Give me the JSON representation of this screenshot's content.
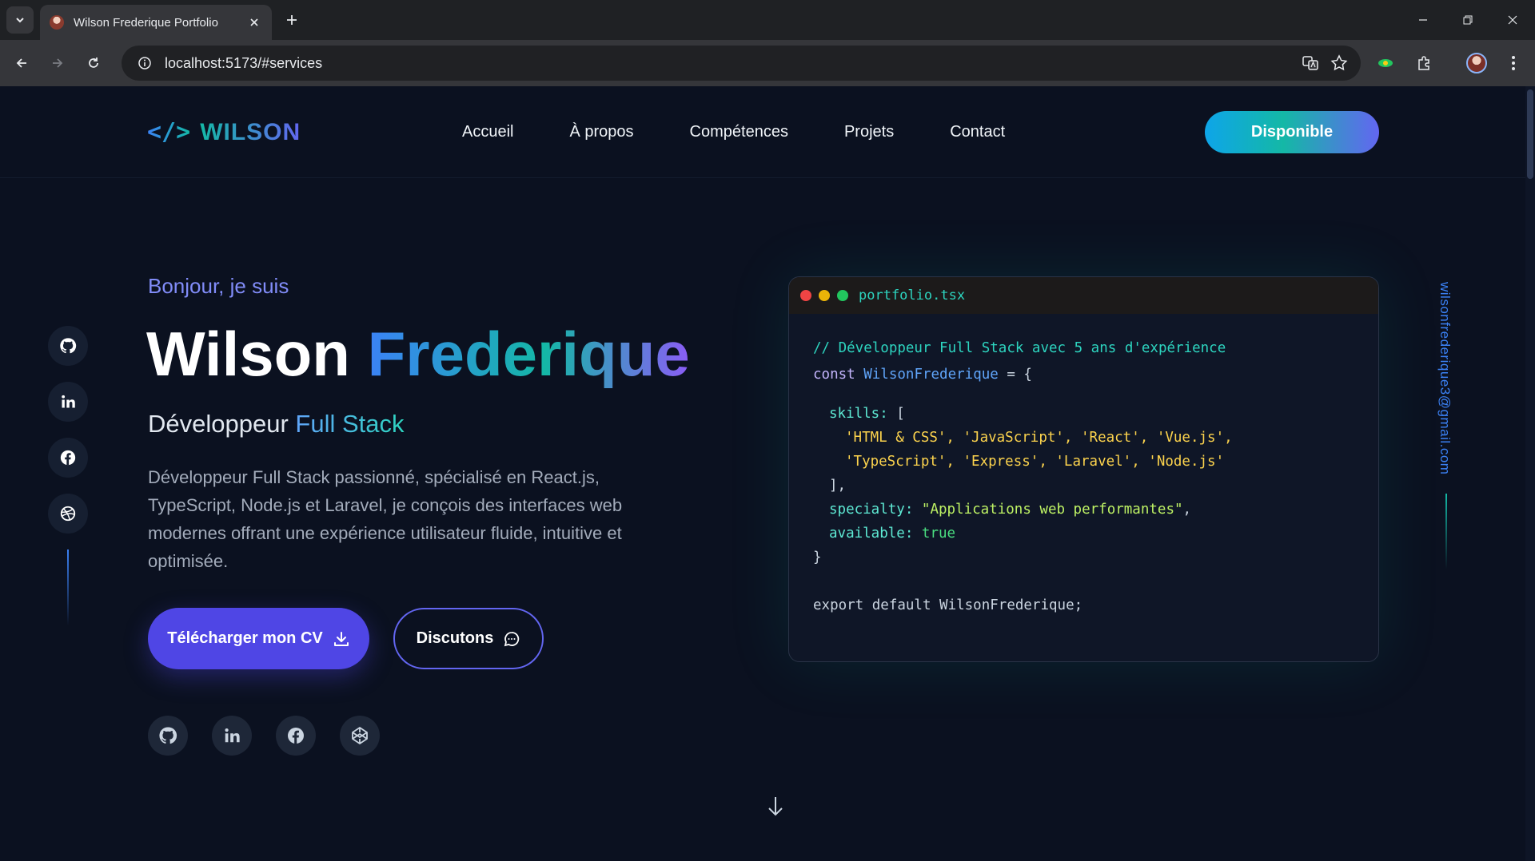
{
  "browser": {
    "tab_title": "Wilson Frederique Portfolio",
    "url": "localhost:5173/#services"
  },
  "nav": {
    "logo_mark": "</>",
    "logo_text": "WILSON",
    "items": [
      "Accueil",
      "À propos",
      "Compétences",
      "Projets",
      "Contact"
    ],
    "cta": "Disponible"
  },
  "hero": {
    "greeting": "Bonjour, je suis",
    "first_name": "Wilson",
    "last_name": "Frederique",
    "role_prefix": "Développeur",
    "role_accent": "Full Stack",
    "description": "Développeur Full Stack passionné, spécialisé en React.js, TypeScript, Node.js et Laravel, je conçois des interfaces web modernes offrant une expérience utilisateur fluide, intuitive et optimisée.",
    "btn_cv": "Télécharger mon CV",
    "btn_talk": "Discutons"
  },
  "socials": [
    "github-icon",
    "linkedin-icon",
    "facebook-icon",
    "dribbble-icon"
  ],
  "hero_socials": [
    "github-icon",
    "linkedin-icon",
    "facebook-icon",
    "codepen-icon"
  ],
  "code": {
    "filename": "portfolio.tsx",
    "comment": "// Développeur Full Stack avec 5 ans d'expérience",
    "const_kw": "const",
    "var_name": "WilsonFrederique",
    "eq_open": " = {",
    "skills_key": "skills:",
    "bracket_open": " [",
    "skills_line1": "'HTML & CSS', 'JavaScript', 'React', 'Vue.js',",
    "skills_line2": "'TypeScript', 'Express', 'Laravel', 'Node.js'",
    "bracket_close": "],",
    "specialty_key": "specialty:",
    "specialty_val": "\"Applications web performantes\"",
    "comma": ",",
    "available_key": "available:",
    "available_val": "true",
    "brace_close": "}",
    "export_line": "export default WilsonFrederique;"
  },
  "side_email": "wilsonfrederique3@gmail.com",
  "colors": {
    "background": "#0b1120",
    "primary": "#4f46e5",
    "teal": "#14b8a6",
    "blue": "#3b82f6"
  }
}
